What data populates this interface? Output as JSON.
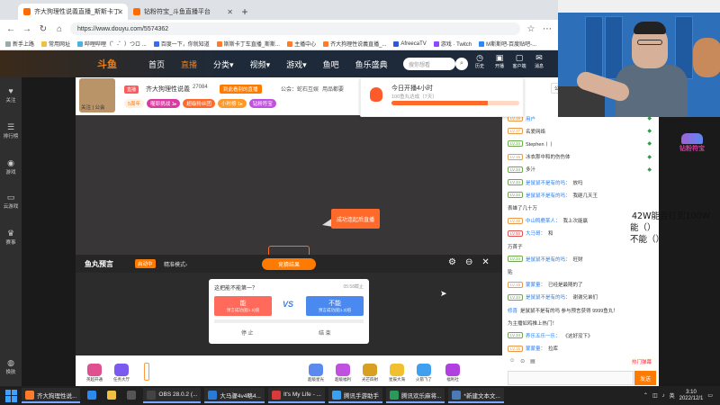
{
  "browser": {
    "tabs": [
      {
        "label": "齐大狗理性说義直播_斯斯卡丁车",
        "active": true
      },
      {
        "label": "钻粉符宝_斗鱼直播平台",
        "active": false
      }
    ],
    "new_tab": "+",
    "url": "https://www.douyu.com/5574362",
    "bookmarks": [
      "新手上路",
      "常用网址",
      "哔哩哔哩（゜-゜）つロ ...",
      "百度一下，你就知道",
      "斯斯卡丁车直播_斯斯...",
      "主播中心",
      "齐大狗理性说義直播_...",
      "AfreecaTV",
      "游戏 · Twitch",
      "M斯斯吧-百度贴吧-..."
    ]
  },
  "douyu_header": {
    "logo": "斗鱼",
    "nav": [
      "首页",
      "直播",
      "分类▾",
      "视频▾",
      "游戏▾",
      "鱼吧",
      "鱼乐盛典"
    ],
    "active_nav": "直播",
    "search_placeholder": "搜你想看",
    "search_icon": "search-icon",
    "icons": [
      {
        "name": "history-icon",
        "glyph": "◷",
        "label": "历史"
      },
      {
        "name": "broadcast-icon",
        "glyph": "▣",
        "label": "开播"
      },
      {
        "name": "client-icon",
        "glyph": "▢",
        "label": "客户端"
      },
      {
        "name": "message-icon",
        "glyph": "✉",
        "label": "消息"
      }
    ]
  },
  "sidebar": {
    "items": [
      {
        "name": "follow",
        "glyph": "♥",
        "label": "关注"
      },
      {
        "name": "ranking",
        "glyph": "☰",
        "label": "排行榜"
      },
      {
        "name": "game",
        "glyph": "◉",
        "label": "游戏"
      },
      {
        "name": "cloud-game",
        "glyph": "▭",
        "label": "云游戏"
      },
      {
        "name": "event",
        "glyph": "♛",
        "label": "赛事"
      },
      {
        "name": "skin",
        "glyph": "◍",
        "label": "换肤"
      }
    ]
  },
  "room": {
    "anchor_label": "关注 | 公会",
    "tag": "直播",
    "title": "齐大狗理性说義",
    "hot": "27084",
    "subscribe_btn": "到此看别的直播",
    "notice": "公会：蛇石互娱",
    "sub": "用品都要",
    "badges": [
      {
        "label": "5周年",
        "bg": "#fff0e6",
        "color": "#ff7a00"
      },
      {
        "label": "喔耶挑战 1▸",
        "bg": "#d93aa0",
        "color": "#ffffff"
      },
      {
        "label": "超级粉丝团",
        "bg": "#ff6a2a",
        "color": "#ffffff"
      },
      {
        "label": "小时榜 1▸",
        "bg": "#ff9a2a",
        "color": "#ffffff"
      },
      {
        "label": "钻粉符宝",
        "bg": "#c050e0",
        "color": "#ffffff"
      }
    ]
  },
  "video": {
    "enter_btn": "成功连起后直播"
  },
  "checkin": {
    "title": "今日开播4小时",
    "sub": "100鱼丸达成（7天）",
    "progress": 0.75
  },
  "right_tabs": [
    "公聊",
    "贵宾"
  ],
  "prediction": {
    "title": "鱼丸预言",
    "tag": "启动中",
    "mode": "精准模式›",
    "center_btn": "竞猜结果",
    "question": "这把能不能第一？",
    "time": "05:58截止",
    "option_a": {
      "label": "能",
      "sub": "预言成功(赔1.5)倍"
    },
    "option_b": {
      "label": "不能",
      "sub": "预言成功(赔1.3)倍"
    },
    "vs": "VS",
    "action_left": "停 止",
    "action_right": "结 束"
  },
  "gifts": [
    {
      "label": "英超开通",
      "color": "#e05090"
    },
    {
      "label": "任务大厅",
      "color": "#7a5af0"
    },
    {
      "label": "超级星光",
      "color": "#5a8af0"
    },
    {
      "label": "超级福利",
      "color": "#c050e0"
    },
    {
      "label": "光芒四射",
      "color": "#d8a020"
    },
    {
      "label": "星辰大海",
      "color": "#f0c030"
    },
    {
      "label": "火箭飞了",
      "color": "#40a0f0"
    },
    {
      "label": "福利社",
      "color": "#b040e0"
    }
  ],
  "chat": {
    "rows": [
      {
        "level": "LV.16",
        "lvcolor": "#e89a4a",
        "user": "用户",
        "text": "",
        "diamond": true
      },
      {
        "level": "LV.17",
        "lvcolor": "#e89a4a",
        "user": "",
        "text": "名爱网络",
        "diamond": true
      },
      {
        "level": "LV.34",
        "lvcolor": "#6aaa4a",
        "user": "",
        "text": "Stephen丨丨",
        "diamond": true
      },
      {
        "level": "LV.15",
        "lvcolor": "#e89a4a",
        "user": "",
        "text": "冰衣那中和的伤伤体",
        "diamond": true
      },
      {
        "level": "LV.34",
        "lvcolor": "#6aaa4a",
        "user": "",
        "text": "多汁",
        "diamond": true
      },
      {
        "level": "LV.34",
        "lvcolor": "#6aaa4a",
        "user": "是鼠鼠不是有的吗：",
        "text": "放吗",
        "diamond": false
      },
      {
        "level": "LV.34",
        "lvcolor": "#6aaa4a",
        "user": "是鼠鼠不是有的吗：",
        "text": "我砸几天王",
        "diamond": false
      },
      {
        "level": "",
        "lvcolor": "#999999",
        "user": "",
        "text": "表雄了几十万",
        "diamond": false
      },
      {
        "level": "LV.28",
        "lvcolor": "#e89a4a",
        "user": "中山鸭鹿某人：",
        "text": "我上次能赢",
        "diamond": false
      },
      {
        "level": "LV.50",
        "lvcolor": "#e05050",
        "user": "大马哥：",
        "text": "和",
        "diamond": false
      },
      {
        "level": "",
        "lvcolor": "#999999",
        "user": "",
        "text": "万首子",
        "diamond": false
      },
      {
        "level": "LV.34",
        "lvcolor": "#6aaa4a",
        "user": "是鼠鼠不是有的吗：",
        "text": "旺财",
        "diamond": false
      },
      {
        "level": "",
        "lvcolor": "#999999",
        "user": "",
        "text": "贴",
        "diamond": false
      },
      {
        "level": "LV.15",
        "lvcolor": "#e89a4a",
        "user": "蒙蒙量：",
        "text": "已经是最随的了",
        "diamond": false
      },
      {
        "level": "LV.34",
        "lvcolor": "#6aaa4a",
        "user": "是鼠鼠不是有的吗：",
        "text": "谢谢兄弟们",
        "diamond": false
      },
      {
        "level": "",
        "lvcolor": "#999999",
        "user": "修喜",
        "text": "是鼠鼠不是有的吗 参与预言获得 9999鱼丸！",
        "diamond": false
      },
      {
        "level": "",
        "lvcolor": "#999999",
        "user": "",
        "text": "为主播如鸡推上热门！",
        "diamond": false
      },
      {
        "level": "LV.34",
        "lvcolor": "#6aaa4a",
        "user": "养乐五乐一乐：",
        "text": "《这好没下》",
        "diamond": false
      },
      {
        "level": "LV.15",
        "lvcolor": "#e89a4a",
        "user": "蒙蒙量：",
        "text": "拉库",
        "diamond": false
      }
    ],
    "tools": [
      "☺",
      "⊙",
      "▤"
    ],
    "hotword": "热门弹幕",
    "send": "发送"
  },
  "overlay": {
    "line1": "42W能否打到100W",
    "line2": "能（）",
    "line3": "不能（）"
  },
  "webcam_logo": "钻粉符宝",
  "taskbar": {
    "apps": [
      {
        "label": "齐大狗理性说...",
        "color": "#ff7a2a",
        "open": true
      },
      {
        "label": "",
        "color": "#2a8af0",
        "open": false
      },
      {
        "label": "",
        "color": "#f0c040",
        "open": false
      },
      {
        "label": "",
        "color": "#555555",
        "open": false
      },
      {
        "label": "OBS 28.0.2 (...",
        "color": "#444444",
        "open": true
      },
      {
        "label": "大马骤4v4略4...",
        "color": "#2a7ad8",
        "open": true
      },
      {
        "label": "It's My Life - ...",
        "color": "#d83a3a",
        "open": true
      },
      {
        "label": "腾讯手游助手",
        "color": "#3aa0f0",
        "open": true
      },
      {
        "label": "腾讯欢乐麻将...",
        "color": "#2a9a5a",
        "open": true
      },
      {
        "label": "*新建文本文...",
        "color": "#4a7ab8",
        "open": true
      }
    ],
    "tray_lang": "英",
    "time": "3:10",
    "date": "2022/12/1"
  }
}
